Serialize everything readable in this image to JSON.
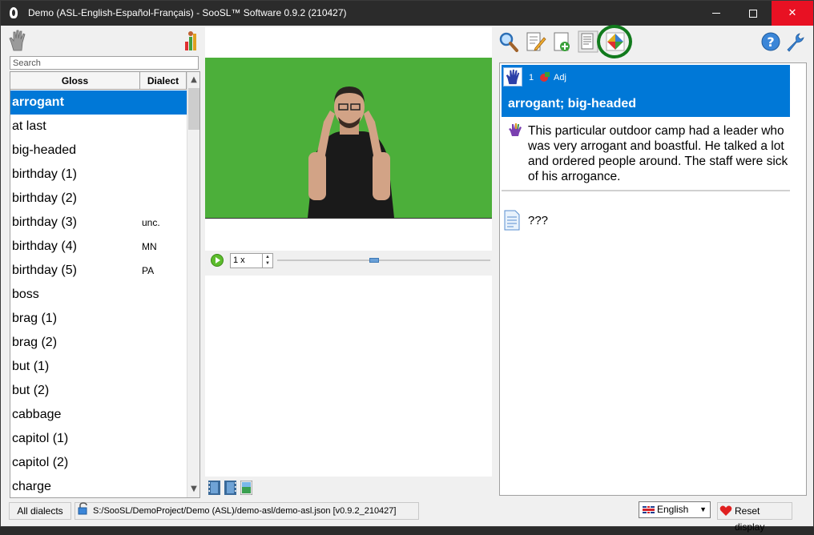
{
  "window": {
    "title": "Demo (ASL-English-Español-Français) - SooSL™ Software 0.9.2 (210427)"
  },
  "search": {
    "placeholder": "Search",
    "value": ""
  },
  "list": {
    "columns": {
      "gloss": "Gloss",
      "dialect": "Dialect"
    },
    "rows": [
      {
        "gloss": "arrogant",
        "dialect": ""
      },
      {
        "gloss": "at last",
        "dialect": ""
      },
      {
        "gloss": "big-headed",
        "dialect": ""
      },
      {
        "gloss": "birthday (1)",
        "dialect": ""
      },
      {
        "gloss": "birthday (2)",
        "dialect": ""
      },
      {
        "gloss": "birthday (3)",
        "dialect": "unc."
      },
      {
        "gloss": "birthday (4)",
        "dialect": "MN"
      },
      {
        "gloss": "birthday (5)",
        "dialect": "PA"
      },
      {
        "gloss": "boss",
        "dialect": ""
      },
      {
        "gloss": "brag (1)",
        "dialect": ""
      },
      {
        "gloss": "brag (2)",
        "dialect": ""
      },
      {
        "gloss": "but (1)",
        "dialect": ""
      },
      {
        "gloss": "but (2)",
        "dialect": ""
      },
      {
        "gloss": "cabbage",
        "dialect": ""
      },
      {
        "gloss": "capitol (1)",
        "dialect": ""
      },
      {
        "gloss": "capitol (2)",
        "dialect": ""
      },
      {
        "gloss": "charge",
        "dialect": ""
      }
    ]
  },
  "player": {
    "speed": "1 x",
    "position_fraction": 0.45
  },
  "entry": {
    "sense_number": "1",
    "part_of_speech": "Adj",
    "glosses": "arrogant; big-headed",
    "sentence": "This particular outdoor camp had a leader who was very arrogant and boastful. He talked a lot and ordered people around. The staff were sick of his arrogance.",
    "extra_text": "???"
  },
  "status": {
    "dialects": "All dialects",
    "path": "S:/SooSL/DemoProject/Demo (ASL)/demo-asl/demo-asl.json [v0.9.2_210427]",
    "language": "English",
    "reset": "Reset display"
  },
  "colors": {
    "selection": "#0078d7",
    "close": "#e81123",
    "highlight_ring": "#117a1c",
    "green_screen": "#4caf3a"
  }
}
